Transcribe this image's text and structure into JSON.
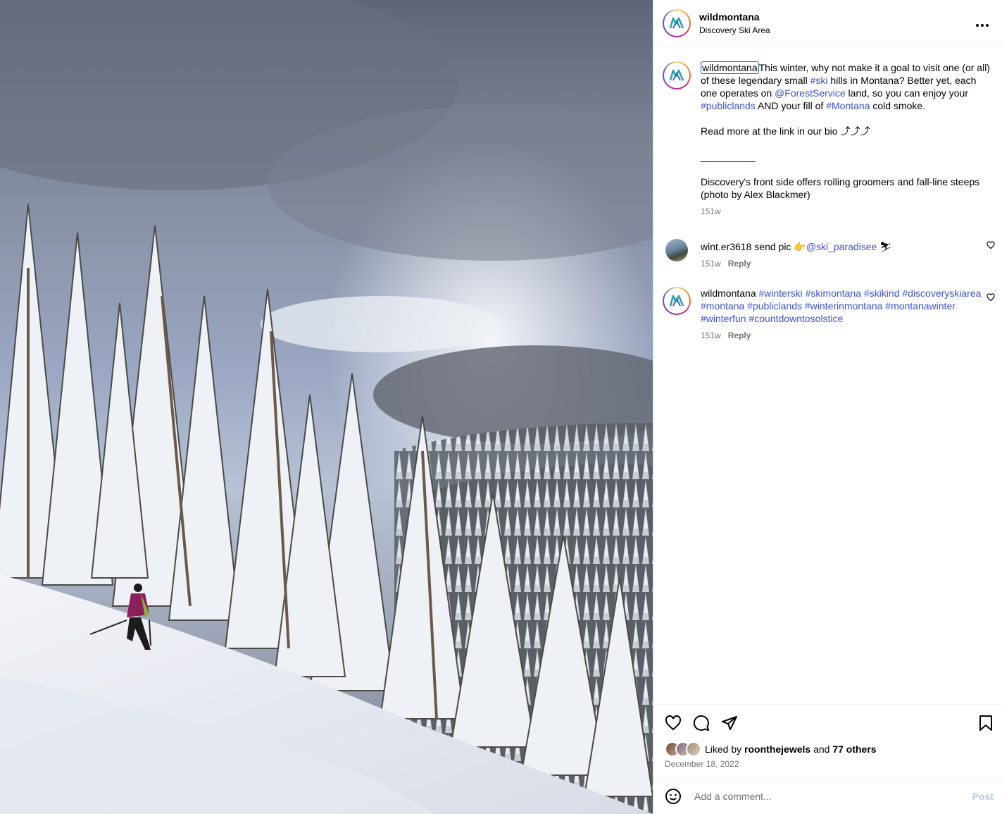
{
  "post": {
    "username": "wildmontana",
    "location": "Discovery Ski Area",
    "more_icon": "more-horizontal-icon"
  },
  "caption": {
    "username": "wildmontana",
    "t1": "This winter, why not make it a goal to visit one (or all) of these legendary small ",
    "tag_ski": "#ski",
    "t2": " hills in Montana? Better yet, each one operates on ",
    "tag_forest": "@ForestService",
    "t3": " land, so you can enjoy your ",
    "tag_publiclands": "#publiclands",
    "t4": " AND your fill of ",
    "tag_montana": "#Montana",
    "t5": " cold smoke.",
    "read_more": "Read more at the link in our bio ⤴⤴⤴",
    "divider": "__________",
    "photo_note": "Discovery's front side offers rolling groomers and fall-line steeps (photo by Alex Blackmer)",
    "age": "151w"
  },
  "comments": [
    {
      "username": "wint.er3618",
      "text": "send pic 👉",
      "mention": "@ski_paradisee",
      "emoji": "⛷",
      "age": "151w",
      "reply": "Reply"
    },
    {
      "username": "wildmontana",
      "tags": "#winterski #skimontana #skikind #discoveryskiarea #montana #publiclands #winterinmontana #montanawinter #winterfun #countdowntosolstice",
      "age": "151w",
      "reply": "Reply"
    }
  ],
  "likes": {
    "prefix": "Liked by ",
    "user": "roonthejewels",
    "and": " and ",
    "others": "77 others"
  },
  "date": "December 18, 2022",
  "add_comment": {
    "placeholder": "Add a comment...",
    "post_label": "Post"
  },
  "colors": {
    "link": "#3a52d6",
    "post_disabled": "#b3cdf5",
    "brand_teal": "#2aa3a8"
  }
}
